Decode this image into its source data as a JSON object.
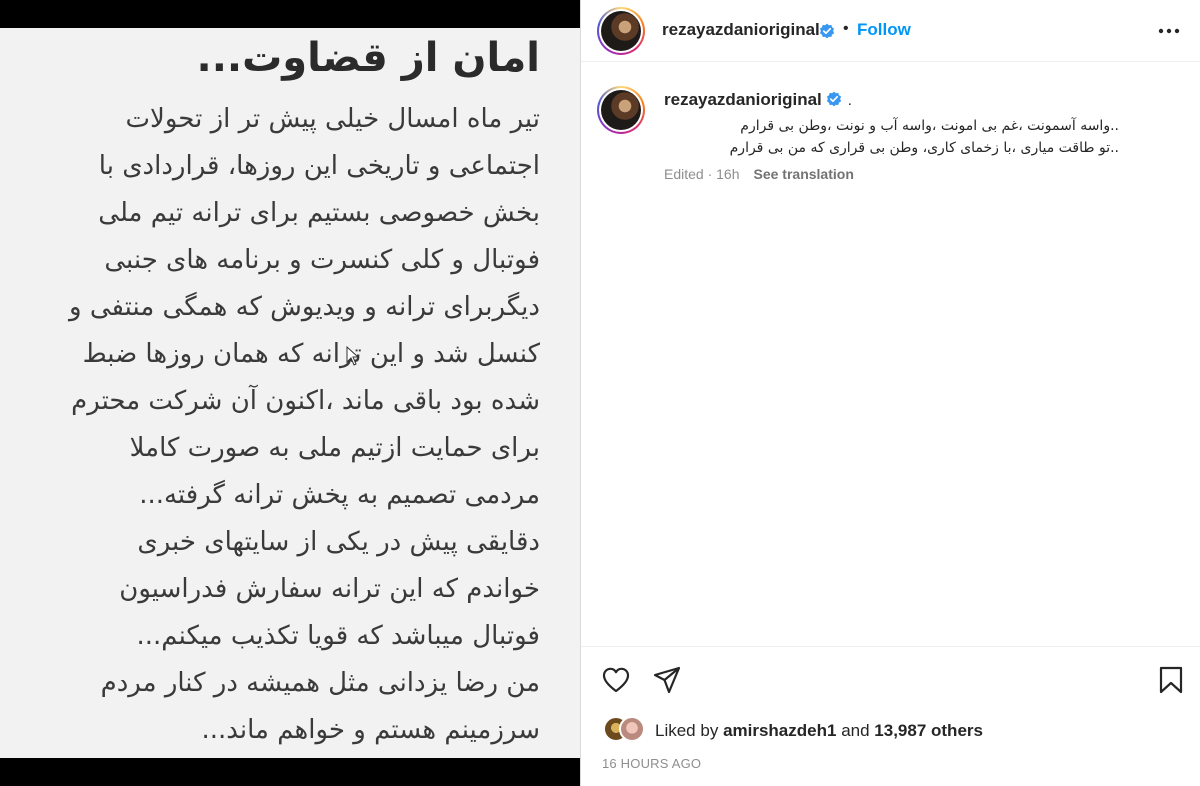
{
  "post_image": {
    "title": "امان از قضاوت...",
    "lines": [
      "تیر ماه امسال خیلی پیش تر از تحولات",
      "اجتماعی و تاریخی این روزها، قراردادی با",
      "بخش خصوصی بستیم برای ترانه تیم ملی",
      "فوتبال و کلی کنسرت و برنامه های جنبی",
      "دیگربرای ترانه و ویدیوش که همگی منتفی و",
      "کنسل شد و این ترانه که همان روزها ضبط",
      "شده بود باقی ماند ،اکنون آن شرکت محترم",
      "برای حمایت ازتیم ملی به صورت کاملا",
      "مردمی تصمیم به پخش ترانه گرفته...",
      "دقایقی پیش در یکی از سایتهای خبری",
      "خواندم  که این ترانه سفارش فدراسیون",
      "فوتبال میباشد که قویا تکذیب میکنم...",
      "من رضا یزدانی مثل همیشه در کنار مردم",
      "سرزمینم هستم و خواهم ماند..."
    ]
  },
  "header": {
    "username": "rezayazdanioriginal",
    "separator": "•",
    "follow_label": "Follow",
    "icons": {
      "verified": "verified-badge-icon",
      "more": "more-options-icon"
    }
  },
  "caption": {
    "username": "rezayazdanioriginal",
    "dot": ".",
    "lines": [
      "..واسه آسمونت ،غم بی امونت ،واسه آب و نونت ،وطن بی قرارم",
      "..تو طاقت میاری ،با زخمای کاری، وطن بی قراری که من بی قرارم"
    ],
    "meta": "Edited · 16h",
    "see_translation": "See translation"
  },
  "actions": {
    "icons": {
      "like": "heart-icon",
      "share": "paper-plane-icon",
      "save": "bookmark-icon"
    }
  },
  "likes": {
    "prefix": "Liked by",
    "user": "amirshazdeh1",
    "middle": "and",
    "others": "13,987 others"
  },
  "timestamp": "16 HOURS AGO",
  "colors": {
    "link": "#0095f6",
    "text": "#262626",
    "muted": "#8e8e8e"
  }
}
